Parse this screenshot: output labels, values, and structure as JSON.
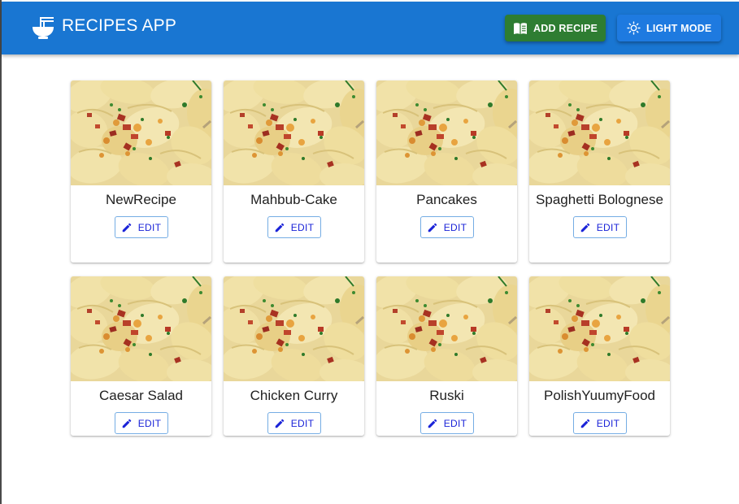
{
  "app": {
    "title": "RECIPES APP",
    "brand_icon": "ramen-bowl-icon"
  },
  "toolbar": {
    "add_label": "ADD RECIPE",
    "add_icon": "menu-book-icon",
    "mode_label": "LIGHT MODE",
    "mode_icon": "sun-icon"
  },
  "colors": {
    "appbar": "#1976d2",
    "add_button": "#2e7d32",
    "mode_button": "#1e7ae0",
    "edit_text": "#1a23d8"
  },
  "recipes": [
    {
      "name": "NewRecipe",
      "edit_label": "EDIT"
    },
    {
      "name": "Mahbub-Cake",
      "edit_label": "EDIT"
    },
    {
      "name": "Pancakes",
      "edit_label": "EDIT"
    },
    {
      "name": "Spaghetti Bolognese",
      "edit_label": "EDIT"
    },
    {
      "name": "Caesar Salad",
      "edit_label": "EDIT"
    },
    {
      "name": "Chicken Curry",
      "edit_label": "EDIT"
    },
    {
      "name": "Ruski",
      "edit_label": "EDIT"
    },
    {
      "name": "PolishYuumyFood",
      "edit_label": "EDIT"
    }
  ]
}
